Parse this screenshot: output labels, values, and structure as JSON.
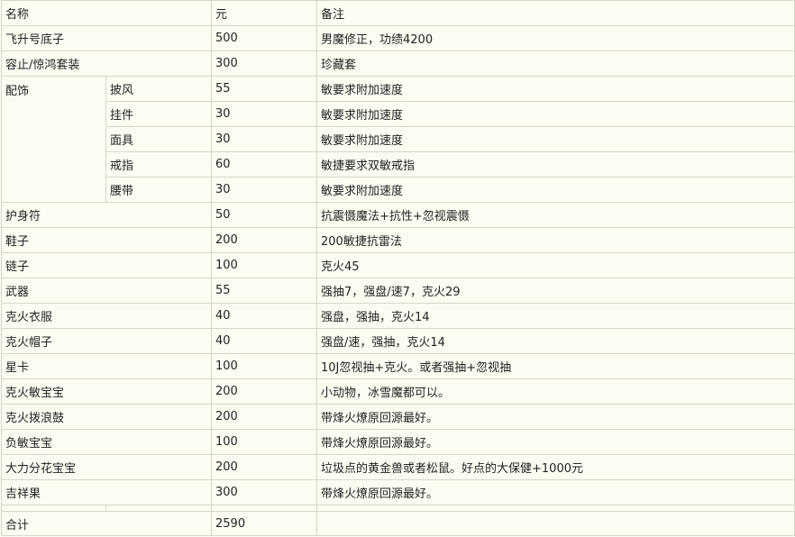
{
  "header": {
    "name": "名称",
    "price": "元",
    "note": "备注"
  },
  "rows": [
    {
      "name": "飞升号底子",
      "price": "500",
      "note": "男魔修正，功绩4200"
    },
    {
      "name": "容止/惊鸿套装",
      "price": "300",
      "note": "珍藏套"
    },
    {
      "name": "护身符",
      "price": "50",
      "note": "抗震慑魔法+抗性+忽视震慑"
    },
    {
      "name": "鞋子",
      "price": "200",
      "note": "200敏捷抗雷法"
    },
    {
      "name": "链子",
      "price": "100",
      "note": "克火45"
    },
    {
      "name": "武器",
      "price": "55",
      "note": "强抽7，强盘/速7，克火29"
    },
    {
      "name": "克火衣服",
      "price": "40",
      "note": "强盘，强抽，克火14"
    },
    {
      "name": "克火帽子",
      "price": "40",
      "note": "强盘/速，强抽，克火14"
    },
    {
      "name": "星卡",
      "price": "100",
      "note": "10J忽视抽+克火。或者强抽+忽视抽"
    },
    {
      "name": "克火敏宝宝",
      "price": "200",
      "note": "小动物，冰雪魔都可以。"
    },
    {
      "name": "克火拨浪鼓",
      "price": "200",
      "note": "带烽火燎原回源最好。"
    },
    {
      "name": "负敏宝宝",
      "price": "100",
      "note": "带烽火燎原回源最好。"
    },
    {
      "name": "大力分花宝宝",
      "price": "200",
      "note": "垃圾点的黄金兽或者松鼠。好点的大保健+1000元"
    },
    {
      "name": "吉祥果",
      "price": "300",
      "note": "带烽火燎原回源最好。"
    }
  ],
  "accessories": {
    "group": "配饰",
    "items": [
      {
        "name": "披风",
        "price": "55",
        "note": "敏要求附加速度"
      },
      {
        "name": "挂件",
        "price": "30",
        "note": "敏要求附加速度"
      },
      {
        "name": "面具",
        "price": "30",
        "note": "敏要求附加速度"
      },
      {
        "name": "戒指",
        "price": "60",
        "note": "敏捷要求双敏戒指"
      },
      {
        "name": "腰带",
        "price": "30",
        "note": "敏要求附加速度"
      }
    ]
  },
  "total": {
    "label": "合计",
    "price": "2590",
    "note": ""
  }
}
